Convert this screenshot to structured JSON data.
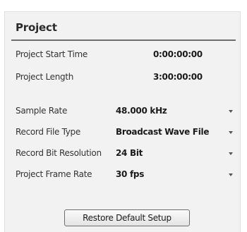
{
  "panel": {
    "title": "Project"
  },
  "fields": {
    "start_time": {
      "label": "Project Start Time",
      "value": "0:00:00:00"
    },
    "length": {
      "label": "Project Length",
      "value": "3:00:00:00"
    },
    "sample_rate": {
      "label": "Sample Rate",
      "value": "48.000 kHz"
    },
    "record_file_type": {
      "label": "Record File Type",
      "value": "Broadcast Wave File"
    },
    "bit_resolution": {
      "label": "Record Bit Resolution",
      "value": "24 Bit"
    },
    "frame_rate": {
      "label": "Project Frame Rate",
      "value": "30 fps"
    }
  },
  "buttons": {
    "restore_label": "Restore Default Setup"
  },
  "icons": {
    "dropdown": "chevron-down-icon"
  }
}
